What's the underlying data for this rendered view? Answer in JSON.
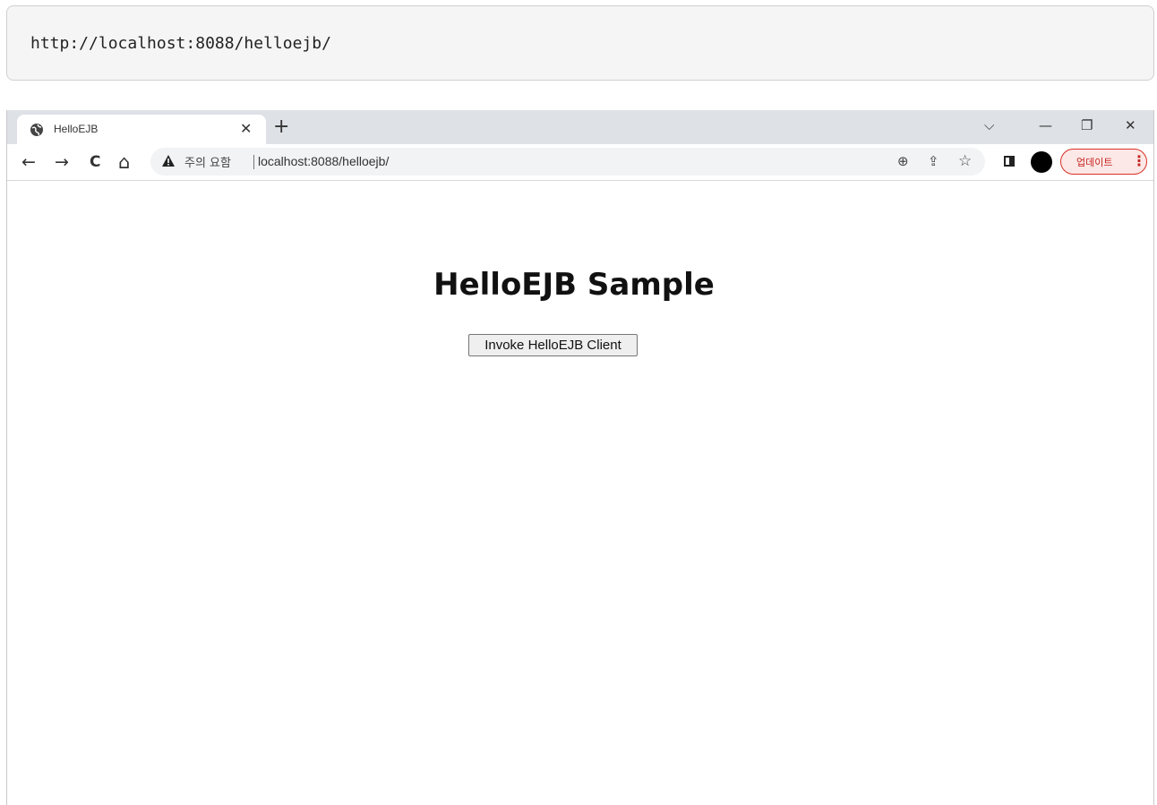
{
  "code_block": {
    "url": "http://localhost:8088/helloejb/"
  },
  "browser": {
    "tab": {
      "title": "HelloEJB",
      "close_glyph": "✕",
      "favicon": "globe-icon"
    },
    "new_tab_glyph": "+",
    "window_controls": {
      "tab_search": "⌵",
      "minimize": "—",
      "restore": "❐",
      "close": "✕"
    },
    "toolbar": {
      "back": "←",
      "forward": "→",
      "reload": "C",
      "home": "⌂",
      "security_warning": "주의 요함",
      "url": "localhost:8088/helloejb/",
      "zoom_icon": "⊕",
      "share_icon": "⇪",
      "bookmark_icon": "☆",
      "update_label": "업데이트",
      "menu_glyph": "⋮"
    },
    "colors": {
      "tabstrip_bg": "#dee1e6",
      "omnibox_bg": "#f1f3f4",
      "update_accent": "#d93025"
    }
  },
  "page": {
    "title": "HelloEJB Sample",
    "invoke_button_label": "Invoke HelloEJB Client"
  }
}
